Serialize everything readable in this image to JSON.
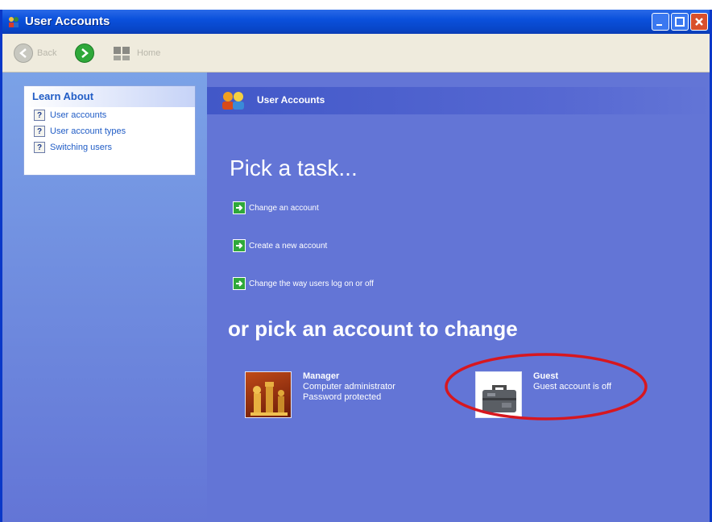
{
  "window": {
    "title": "User Accounts",
    "colors": {
      "title_bar": "#0a50dc",
      "task_pane": "#6375d6",
      "accent_text": "#215dc6",
      "callout_red": "#d7171f"
    }
  },
  "toolbar": {
    "back_label": "Back",
    "home_label": "Home"
  },
  "learn_about": {
    "heading": "Learn About",
    "items": [
      {
        "label": "User accounts",
        "icon": "help-icon"
      },
      {
        "label": "User account types",
        "icon": "help-icon"
      },
      {
        "label": "Switching users",
        "icon": "help-icon"
      }
    ]
  },
  "main": {
    "banner_title": "User Accounts",
    "pick_task_heading": "Pick a task...",
    "tasks": [
      {
        "label": "Change an account",
        "icon": "green-arrow-icon"
      },
      {
        "label": "Create a new account",
        "icon": "green-arrow-icon"
      },
      {
        "label": "Change the way users log on or off",
        "icon": "green-arrow-icon"
      }
    ],
    "pick_account_heading": "or pick an account to change",
    "accounts": [
      {
        "name": "Manager",
        "type": "Computer administrator",
        "status": "Password protected",
        "picture": "chess-pieces-image"
      },
      {
        "name": "Guest",
        "type": "Guest account is off",
        "picture": "briefcase-image"
      }
    ]
  }
}
